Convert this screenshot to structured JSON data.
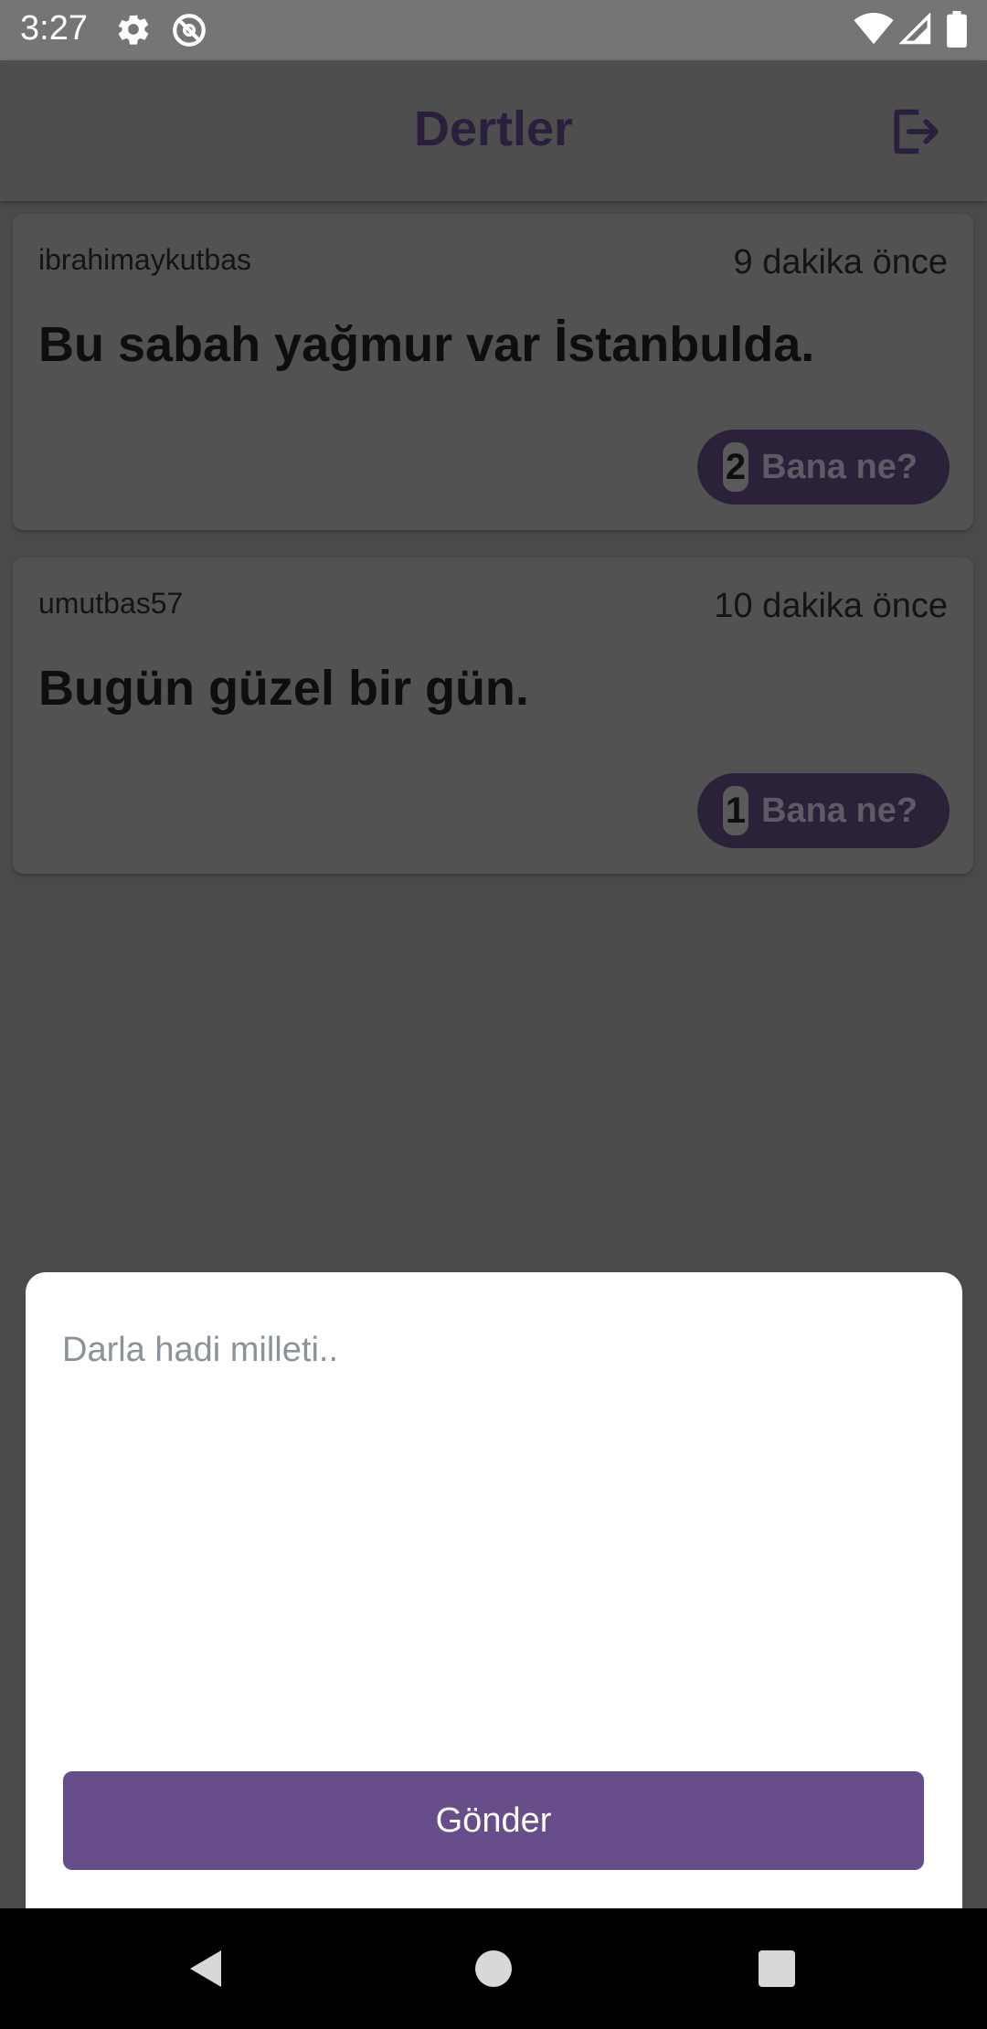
{
  "status_bar": {
    "time": "3:27",
    "icons": [
      "settings-gear-icon",
      "do-not-disturb-icon",
      "wifi-icon",
      "cell-signal-icon",
      "battery-icon"
    ]
  },
  "header": {
    "title": "Dertler",
    "logout_icon": "logout-icon"
  },
  "posts": [
    {
      "username": "ibrahimaykutbas",
      "time_ago": "9 dakika önce",
      "text": "Bu sabah yağmur var İstanbulda.",
      "reaction_count": "2",
      "reaction_label": "Bana ne?"
    },
    {
      "username": "umutbas57",
      "time_ago": "10 dakika önce",
      "text": "Bugün güzel bir gün.",
      "reaction_count": "1",
      "reaction_label": "Bana ne?"
    }
  ],
  "composer": {
    "placeholder": "Darla hadi milleti..",
    "value": "",
    "send_label": "Gönder"
  },
  "nav_bar": {
    "icons": [
      "back-icon",
      "home-icon",
      "recents-icon"
    ]
  },
  "colors": {
    "accent": "#674d8a",
    "scrim_background": "#4a4a4a",
    "status_bar": "#757575",
    "nav_bar": "#000000"
  }
}
